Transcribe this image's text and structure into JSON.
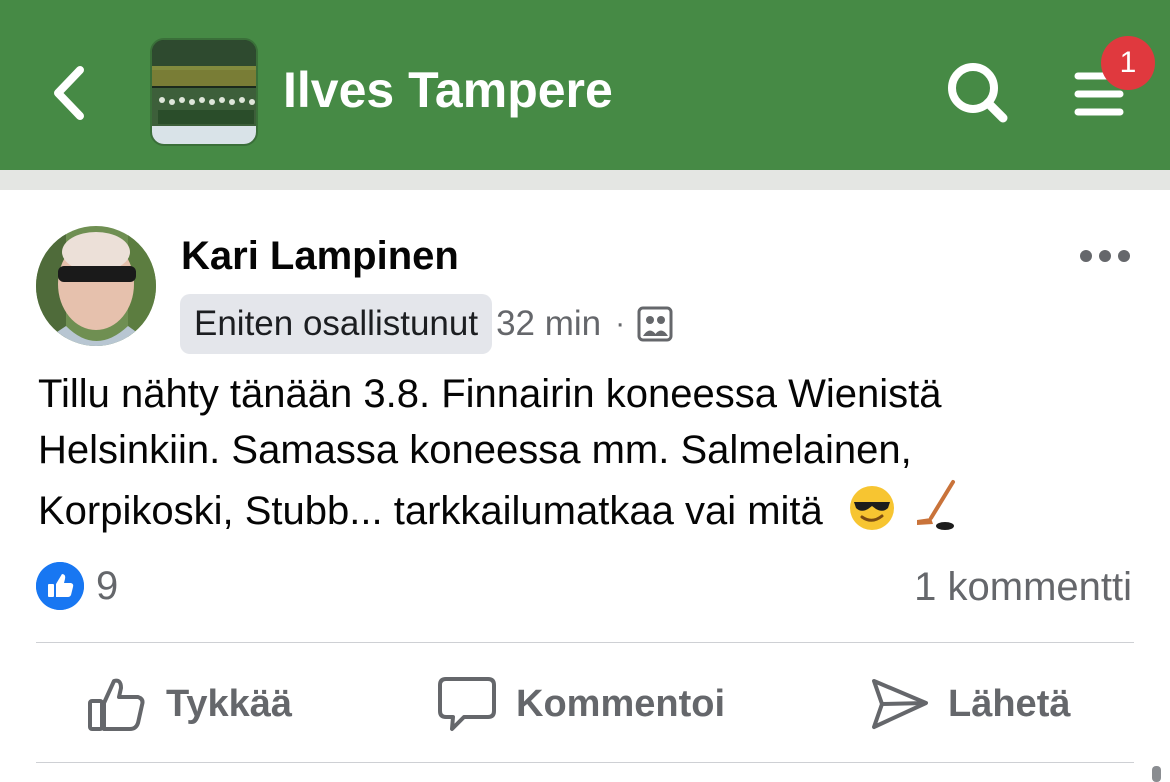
{
  "header": {
    "title": "Ilves Tampere",
    "notification_count": "1",
    "background_color": "#468a45",
    "icons": [
      "chevron-left-icon",
      "search-icon",
      "hamburger-menu-icon"
    ]
  },
  "post": {
    "author": "Kari Lampinen",
    "badge": "Eniten osallistunut",
    "time": "32 min",
    "separator": "·",
    "privacy_icon": "group-members-icon",
    "text_lines": [
      "Tillu nähty tänään 3.8. Finnairin koneessa Wienistä",
      "Helsinkiin. Samassa koneessa mm. Salmelainen,",
      "Korpikoski, Stubb... tarkkailumatkaa vai mitä"
    ],
    "emojis": [
      "sunglasses-smiley-icon",
      "hockey-stick-icon"
    ],
    "reaction_count": "9",
    "comment_count": "1 kommentti"
  },
  "actions": {
    "like": "Tykkää",
    "comment": "Kommentoi",
    "send": "Lähetä"
  }
}
